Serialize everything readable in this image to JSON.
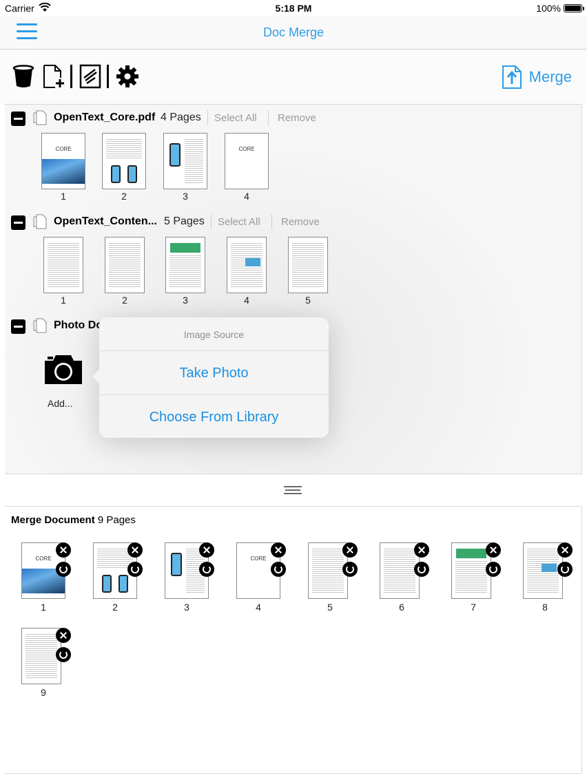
{
  "status_bar": {
    "carrier": "Carrier",
    "time": "5:18 PM",
    "battery": "100%"
  },
  "nav": {
    "title": "Doc Merge"
  },
  "toolbar": {
    "merge_label": "Merge",
    "icons": [
      "trash-icon",
      "new-document-icon",
      "sign-document-icon",
      "settings-gear-icon"
    ]
  },
  "documents": [
    {
      "name": "OpenText_Core.pdf",
      "pages": "4 Pages",
      "select_all": "Select All",
      "remove": "Remove",
      "thumbs": [
        "1",
        "2",
        "3",
        "4"
      ]
    },
    {
      "name": "OpenText_Conten...",
      "pages": "5 Pages",
      "select_all": "Select All",
      "remove": "Remove",
      "thumbs": [
        "1",
        "2",
        "3",
        "4",
        "5"
      ]
    },
    {
      "name": "Photo Do",
      "add_label": "Add..."
    }
  ],
  "popover": {
    "title": "Image Source",
    "take_photo": "Take Photo",
    "choose_library": "Choose From Library"
  },
  "merge": {
    "name": "Merge Document",
    "pages": "9 Pages",
    "thumbs": [
      "1",
      "2",
      "3",
      "4",
      "5",
      "6",
      "7",
      "8",
      "9"
    ]
  },
  "cover_text": "CORE",
  "colors": {
    "accent": "#2d9ce8"
  }
}
